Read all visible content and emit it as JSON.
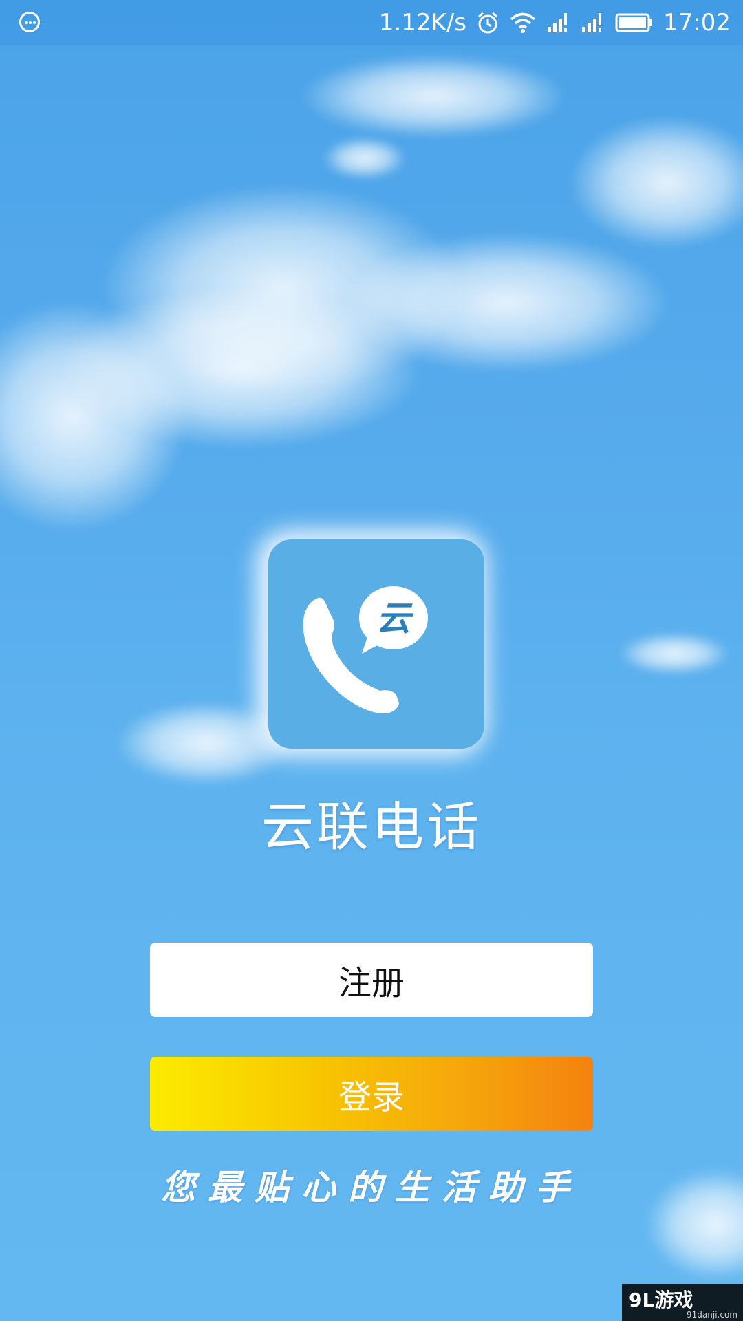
{
  "status_bar": {
    "menu_icon": "more-circle-icon",
    "network_speed": "1.12K/s",
    "icons": [
      "alarm-icon",
      "wifi-icon",
      "signal-icon",
      "signal-icon",
      "battery-icon"
    ],
    "time": "17:02"
  },
  "app": {
    "icon": "phone-cloud-bubble-icon",
    "icon_glyph": "云",
    "title": "云联电话"
  },
  "actions": {
    "register_label": "注册",
    "login_label": "登录"
  },
  "slogan": "您最贴心的生活助手",
  "watermark": {
    "brand": "9L游戏",
    "url": "91danji.com"
  },
  "colors": {
    "sky": "#55aaec",
    "icon_bg": "#5aaee6",
    "login_gradient_start": "#fbec00",
    "login_gradient_end": "#f4820f",
    "register_bg": "#ffffff"
  }
}
